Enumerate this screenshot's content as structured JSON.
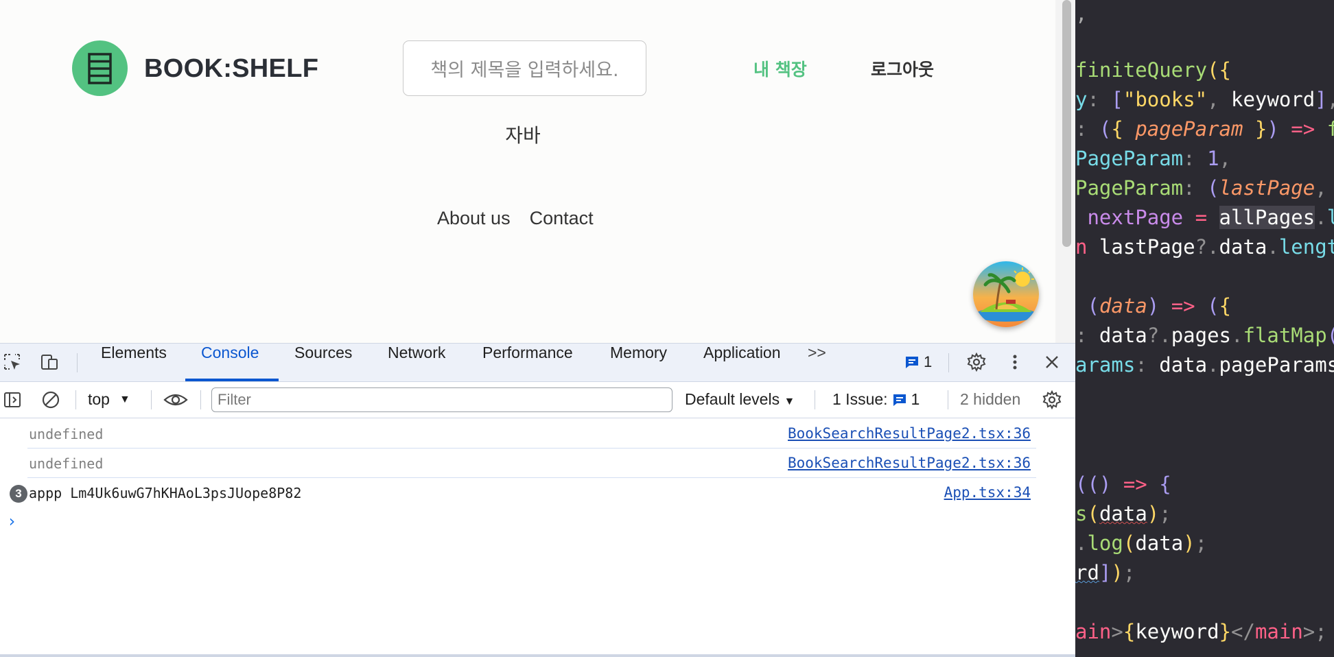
{
  "page": {
    "logo_text": "BOOK:SHELF",
    "search_placeholder": "책의 제목을 입력하세요.",
    "nav_my_bookshelf": "내 책장",
    "nav_logout": "로그아웃",
    "keyword": "자바",
    "footer": {
      "about": "About us",
      "contact": "Contact"
    }
  },
  "devtools": {
    "tabs": [
      "Elements",
      "Console",
      "Sources",
      "Network",
      "Performance",
      "Memory",
      "Application"
    ],
    "active_tab": "Console",
    "more_tabs": ">>",
    "message_count": "1",
    "context": "top",
    "filter_placeholder": "Filter",
    "levels": "Default levels",
    "issues_label": "1 Issue:",
    "issues_count": "1",
    "hidden": "2 hidden",
    "console": [
      {
        "message": "undefined",
        "source": "BookSearchResultPage2.tsx:36"
      },
      {
        "message": "undefined",
        "source": "BookSearchResultPage2.tsx:36"
      },
      {
        "repeat": "3",
        "message": "appp Lm4Uk6uwG7hKHAoL3psJUope8P82",
        "source": "App.tsx:34"
      }
    ],
    "prompt": "›"
  },
  "editor": {
    "lines": [
      ",",
      "finiteQuery({",
      "y: [\"books\", keyword],",
      ": ({ pageParam }) => f",
      "PageParam: 1,",
      "PageParam: (lastPage,",
      " nextPage = allPages.l",
      "n lastPage?.data.lengt",
      "",
      " (data) => ({",
      ": data?.pages.flatMap(",
      "arams: data.pageParams",
      "",
      "",
      "",
      "(() => {",
      "s(data);",
      ".log(data);",
      "rd]);",
      "",
      "ain>{keyword}</main>;"
    ]
  },
  "colors": {
    "brand": "#53c281",
    "devtools_accent": "#0b57d0",
    "editor_bg": "#2b2a31"
  }
}
